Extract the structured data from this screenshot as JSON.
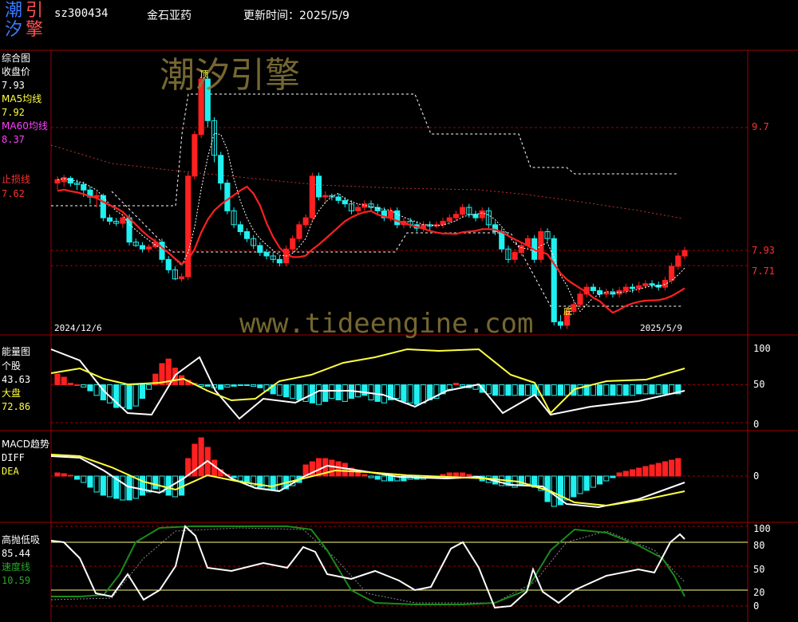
{
  "header": {
    "logo_chars": [
      "潮",
      "引",
      "汐",
      "擎"
    ],
    "stock_code": "sz300434",
    "stock_name": "金石亚药",
    "update_label": "更新时间：2025/5/9"
  },
  "watermark": {
    "brand": "潮汐引擎",
    "url": "www.tideengine.com"
  },
  "colors": {
    "background": "#000000",
    "up": "#ff2020",
    "down": "#20f0f0",
    "ma5": "#ffffff",
    "ma60": "#ff4040",
    "stop_line": "#ff2020",
    "fast_line": "#ffffff",
    "slow_line": "#ffff40",
    "speed_line": "#1a8a1a",
    "grid_red": "#a00000",
    "watermark": "#8a7a3a"
  },
  "panels": {
    "main": {
      "title": "综合图",
      "close_label": "收盘价",
      "close_value": "7.93",
      "ma5_label": "MA5均线",
      "ma5_value": "7.92",
      "ma60_label": "MA60均线",
      "ma60_value": "8.37",
      "stop_label": "止损线",
      "stop_value": "7.62",
      "right_axis": [
        "9.7",
        "7.93",
        "7.71"
      ],
      "date_start": "2024/12/6",
      "date_end": "2025/5/9",
      "top_mark": "顶",
      "bottom_mark": "底"
    },
    "energy": {
      "title": "能量图",
      "stock_label": "个股",
      "stock_value": "43.63",
      "market_label": "大盘",
      "market_value": "72.86",
      "right_axis": [
        "100",
        "50",
        "0"
      ]
    },
    "macd": {
      "title": "MACD趋势",
      "diff_label": "DIFF",
      "dea_label": "DEA",
      "right_axis": [
        "0"
      ]
    },
    "swing": {
      "title": "高抛低吸",
      "value": "85.44",
      "speed_label": "速度线",
      "speed_value": "10.59",
      "right_axis": [
        "100",
        "80",
        "50",
        "20",
        "0"
      ]
    }
  },
  "chart_data": [
    {
      "type": "candlestick",
      "title": "综合图",
      "x_start": "2024/12/6",
      "x_end": "2025/5/9",
      "y_reference": [
        9.7,
        7.93,
        7.71
      ],
      "candles_approx": [
        [
          8.9,
          8.95,
          8.8,
          9.0
        ],
        [
          8.92,
          8.98,
          8.85,
          9.02
        ],
        [
          8.97,
          8.9,
          8.85,
          9.0
        ],
        [
          8.9,
          8.88,
          8.8,
          8.95
        ],
        [
          8.88,
          8.8,
          8.7,
          8.92
        ],
        [
          8.8,
          8.7,
          8.6,
          8.85
        ],
        [
          8.7,
          8.72,
          8.55,
          8.78
        ],
        [
          8.72,
          8.4,
          8.35,
          8.75
        ],
        [
          8.4,
          8.35,
          8.3,
          8.45
        ],
        [
          8.35,
          8.32,
          8.28,
          8.4
        ],
        [
          8.32,
          8.4,
          8.25,
          8.45
        ],
        [
          8.4,
          8.05,
          8.0,
          8.45
        ],
        [
          8.05,
          8.0,
          7.98,
          8.1
        ],
        [
          8.0,
          7.95,
          7.9,
          8.05
        ],
        [
          7.95,
          7.98,
          7.9,
          8.02
        ],
        [
          7.98,
          8.05,
          7.95,
          8.1
        ],
        [
          8.05,
          7.8,
          7.75,
          8.1
        ],
        [
          7.8,
          7.65,
          7.6,
          7.85
        ],
        [
          7.65,
          7.52,
          7.5,
          7.7
        ],
        [
          7.52,
          7.55,
          7.48,
          7.6
        ],
        [
          7.55,
          9.0,
          7.5,
          9.05
        ],
        [
          9.0,
          9.6,
          8.95,
          9.65
        ],
        [
          9.6,
          10.4,
          9.55,
          10.45
        ],
        [
          10.4,
          9.8,
          9.7,
          10.45
        ],
        [
          9.8,
          9.3,
          9.2,
          9.85
        ],
        [
          9.3,
          8.9,
          8.8,
          9.35
        ],
        [
          8.9,
          8.5,
          8.45,
          8.95
        ],
        [
          8.5,
          8.3,
          8.25,
          8.55
        ],
        [
          8.3,
          8.2,
          8.15,
          8.35
        ],
        [
          8.2,
          8.1,
          8.05,
          8.25
        ],
        [
          8.1,
          8.0,
          7.95,
          8.15
        ],
        [
          8.0,
          7.9,
          7.85,
          8.05
        ],
        [
          7.9,
          7.85,
          7.8,
          7.95
        ],
        [
          7.85,
          7.8,
          7.75,
          7.9
        ],
        [
          7.8,
          7.75,
          7.7,
          7.85
        ],
        [
          7.75,
          7.95,
          7.7,
          8.0
        ],
        [
          7.95,
          8.1,
          7.9,
          8.15
        ],
        [
          8.1,
          8.3,
          8.05,
          8.35
        ],
        [
          8.3,
          8.4,
          8.25,
          8.45
        ],
        [
          8.4,
          9.0,
          8.35,
          9.05
        ],
        [
          9.0,
          8.7,
          8.65,
          9.05
        ],
        [
          8.7,
          8.72,
          8.6,
          8.78
        ],
        [
          8.72,
          8.7,
          8.65,
          8.75
        ],
        [
          8.7,
          8.65,
          8.6,
          8.75
        ],
        [
          8.65,
          8.6,
          8.55,
          8.7
        ],
        [
          8.6,
          8.5,
          8.45,
          8.65
        ],
        [
          8.5,
          8.55,
          8.45,
          8.6
        ],
        [
          8.55,
          8.6,
          8.5,
          8.65
        ],
        [
          8.6,
          8.55,
          8.5,
          8.65
        ],
        [
          8.55,
          8.5,
          8.45,
          8.6
        ],
        [
          8.5,
          8.4,
          8.35,
          8.55
        ],
        [
          8.4,
          8.5,
          8.35,
          8.55
        ],
        [
          8.5,
          8.3,
          8.25,
          8.55
        ],
        [
          8.3,
          8.35,
          8.25,
          8.4
        ],
        [
          8.35,
          8.3,
          8.25,
          8.4
        ],
        [
          8.3,
          8.25,
          8.2,
          8.35
        ],
        [
          8.25,
          8.3,
          8.2,
          8.35
        ],
        [
          8.3,
          8.28,
          8.22,
          8.35
        ],
        [
          8.28,
          8.3,
          8.25,
          8.35
        ],
        [
          8.3,
          8.35,
          8.25,
          8.4
        ],
        [
          8.35,
          8.4,
          8.3,
          8.45
        ],
        [
          8.4,
          8.45,
          8.35,
          8.5
        ],
        [
          8.45,
          8.55,
          8.4,
          8.6
        ],
        [
          8.55,
          8.45,
          8.4,
          8.6
        ],
        [
          8.45,
          8.4,
          8.35,
          8.5
        ],
        [
          8.4,
          8.5,
          8.35,
          8.55
        ],
        [
          8.5,
          8.3,
          8.25,
          8.55
        ],
        [
          8.3,
          8.2,
          8.15,
          8.35
        ],
        [
          8.2,
          7.95,
          7.9,
          8.25
        ],
        [
          7.95,
          7.8,
          7.75,
          8.0
        ],
        [
          7.8,
          7.9,
          7.75,
          7.95
        ],
        [
          7.9,
          8.0,
          7.85,
          8.05
        ],
        [
          8.0,
          8.1,
          7.95,
          8.15
        ],
        [
          8.1,
          7.8,
          7.75,
          8.15
        ],
        [
          7.8,
          8.2,
          7.75,
          8.25
        ],
        [
          8.2,
          8.1,
          8.05,
          8.25
        ],
        [
          8.1,
          6.9,
          6.85,
          8.15
        ],
        [
          6.9,
          6.85,
          6.8,
          7.0
        ],
        [
          6.85,
          7.05,
          6.8,
          7.1
        ],
        [
          7.05,
          7.15,
          7.0,
          7.2
        ],
        [
          7.15,
          7.3,
          7.1,
          7.35
        ],
        [
          7.3,
          7.4,
          7.25,
          7.45
        ],
        [
          7.4,
          7.35,
          7.3,
          7.45
        ],
        [
          7.35,
          7.3,
          7.25,
          7.4
        ],
        [
          7.3,
          7.32,
          7.25,
          7.38
        ],
        [
          7.32,
          7.3,
          7.25,
          7.38
        ],
        [
          7.3,
          7.35,
          7.25,
          7.4
        ],
        [
          7.35,
          7.4,
          7.3,
          7.45
        ],
        [
          7.4,
          7.38,
          7.32,
          7.45
        ],
        [
          7.38,
          7.42,
          7.32,
          7.48
        ],
        [
          7.42,
          7.45,
          7.38,
          7.5
        ],
        [
          7.45,
          7.43,
          7.38,
          7.5
        ],
        [
          7.43,
          7.4,
          7.35,
          7.48
        ],
        [
          7.4,
          7.5,
          7.35,
          7.55
        ],
        [
          7.5,
          7.7,
          7.45,
          7.75
        ],
        [
          7.7,
          7.85,
          7.65,
          7.9
        ],
        [
          7.85,
          7.93,
          7.8,
          7.98
        ]
      ]
    },
    {
      "type": "bar+line",
      "title": "能量图",
      "ylim": [
        0,
        100
      ],
      "series": [
        {
          "name": "个股",
          "last": 43.63
        },
        {
          "name": "大盘",
          "last": 72.86
        }
      ]
    },
    {
      "type": "bar+line",
      "title": "MACD趋势",
      "series": [
        {
          "name": "DIFF"
        },
        {
          "name": "DEA"
        }
      ]
    },
    {
      "type": "line",
      "title": "高抛低吸",
      "ylim": [
        0,
        100
      ],
      "series": [
        {
          "name": "高抛低吸",
          "last": 85.44
        },
        {
          "name": "速度线",
          "last": 10.59
        }
      ]
    }
  ]
}
